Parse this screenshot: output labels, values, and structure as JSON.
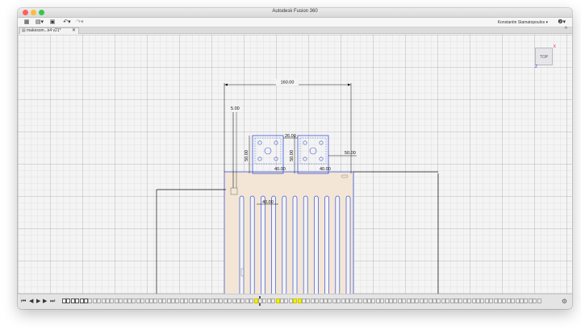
{
  "window": {
    "title": "Autodesk Fusion 360"
  },
  "toolbar": {
    "grid_icon": "grid-icon",
    "file_icon": "file-icon",
    "save_icon": "save-icon",
    "undo_icon": "undo-icon",
    "redo_icon": "redo-icon",
    "grid_glyph": "▦",
    "file_glyph": "▤▾",
    "save_glyph": "▣",
    "undo_glyph": "↶▾",
    "redo_glyph": "↷▾",
    "user_name": "Konstantin Stamatopoulos ▾",
    "help_glyph": "❷▾"
  },
  "tabs": [
    {
      "label": "makesom...k4 v21*",
      "close": "✕",
      "icon": "document-icon"
    }
  ],
  "tab_collapse_glyph": "^",
  "viewcube": {
    "face": "TOP",
    "axis_x": "X",
    "axis_z": "Z"
  },
  "dimensions": {
    "width_total": "160.00",
    "offset_top": "5.00",
    "block_height_left": "50.00",
    "block_height_right": "50.00",
    "gap_top": "26.00",
    "right_offset": "50.00",
    "pitch": "40.00",
    "label_left": "40.00",
    "label_right": "40.00"
  },
  "timeline": {
    "controls": [
      "⏮",
      "◀",
      "▶",
      "▶",
      "⏭"
    ],
    "settings_glyph": "⚙",
    "item_count": 110,
    "selected_items": [
      0,
      1,
      2,
      3,
      4,
      5
    ],
    "highlight_items": [
      44,
      49,
      53,
      54
    ],
    "marker_index": 44
  },
  "colors": {
    "sketch_blue": "#3a54d8",
    "profile_fill": "#f3e6d6",
    "dimension": "#111111",
    "highlight": "#f4f200"
  }
}
